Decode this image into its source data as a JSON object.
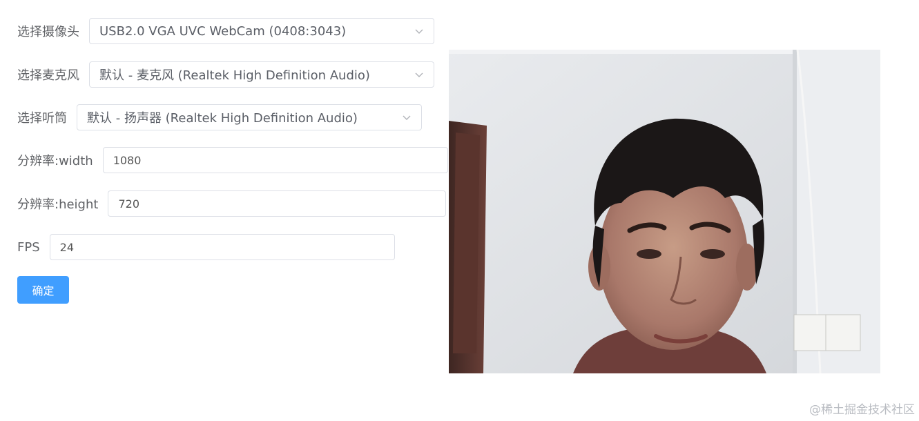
{
  "form": {
    "camera": {
      "label": "选择摄像头",
      "value": "USB2.0 VGA UVC WebCam (0408:3043)"
    },
    "microphone": {
      "label": "选择麦克风",
      "value": "默认 - 麦克风 (Realtek High Definition Audio)"
    },
    "speaker": {
      "label": "选择听筒",
      "value": "默认 - 扬声器 (Realtek High Definition Audio)"
    },
    "width": {
      "label": "分辨率:width",
      "value": "1080"
    },
    "height": {
      "label": "分辨率:height",
      "value": "720"
    },
    "fps": {
      "label": "FPS",
      "value": "24"
    },
    "confirm_label": "确定"
  },
  "preview": {
    "icon": "webcam-video-feed"
  },
  "watermark": "@稀土掘金技术社区",
  "colors": {
    "primary": "#409eff",
    "border": "#dcdfe6",
    "label_text": "#606266"
  }
}
